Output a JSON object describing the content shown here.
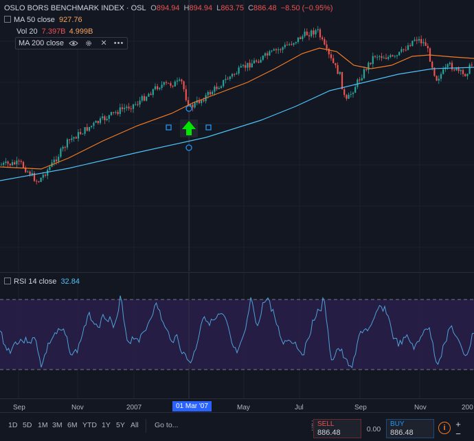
{
  "symbol": {
    "name": "OSLO BORS BENCHMARK INDEX · OSL",
    "open_label": "O",
    "open": "894.94",
    "high_label": "H",
    "high": "894.94",
    "low_label": "L",
    "low": "863.75",
    "close_label": "C",
    "close": "886.48",
    "change": "−8.50 (−0.95%)"
  },
  "indicators": {
    "ma50": {
      "label": "MA 50 close",
      "value": "927.76"
    },
    "vol": {
      "label": "Vol 20",
      "value1": "7.397B",
      "value2": "4.999B"
    },
    "ma200": {
      "label": "MA 200 close"
    }
  },
  "rsi": {
    "label": "RSI 14 close",
    "value": "32.84"
  },
  "x_axis": {
    "labels": [
      "Sep",
      "Nov",
      "2007",
      "Mar",
      "May",
      "Jul",
      "Sep",
      "Nov",
      "200"
    ],
    "crosshair_label": "01 Mar '07"
  },
  "timeframes": [
    "1D",
    "5D",
    "1M",
    "3M",
    "6M",
    "YTD",
    "1Y",
    "5Y",
    "All"
  ],
  "goto_label": "Go to...",
  "trade": {
    "sell_label": "SELL",
    "sell_price": "886.48",
    "spread": "0.00",
    "buy_label": "BUY",
    "buy_price": "886.48"
  },
  "colors": {
    "background": "#131722",
    "up_candle": "#26a69a",
    "down_candle": "#ef5350",
    "ma50": "#f57c24",
    "ma200": "#4fc3f7",
    "rsi_line": "#4fa3d9",
    "rsi_band": "#2a1f4a",
    "arrow": "#00e600"
  }
}
